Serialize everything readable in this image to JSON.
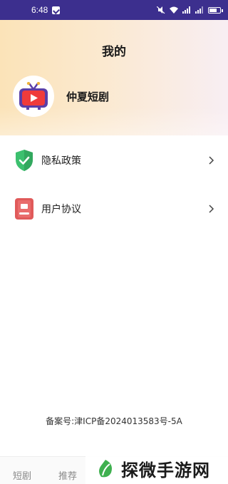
{
  "status_bar": {
    "time": "6:48"
  },
  "header": {
    "title": "我的",
    "app_name": "仲夏短剧"
  },
  "menu": {
    "items": [
      {
        "label": "隐私政策",
        "icon": "shield-check-icon"
      },
      {
        "label": "用户协议",
        "icon": "document-icon"
      }
    ]
  },
  "footer": {
    "icp": "备案号:津ICP备2024013583号-5A"
  },
  "bottom_nav": {
    "tabs": [
      "短剧",
      "推荐"
    ]
  },
  "watermark": {
    "text": "探微手游网"
  },
  "colors": {
    "status_bar": "#3c2f8e",
    "shield_green": "#3cc06e",
    "document_red": "#e05a5a",
    "tv_purple": "#5a3ea8",
    "tv_red": "#ef3b3b"
  }
}
